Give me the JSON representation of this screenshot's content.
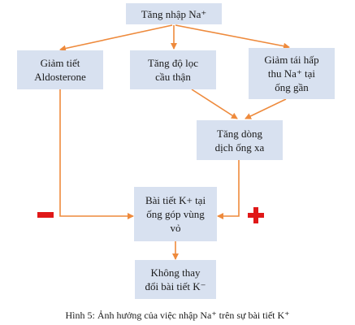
{
  "boxes": {
    "top": [
      "Tăng nhập Na⁺"
    ],
    "left": [
      "Giảm tiết",
      "Aldosterone"
    ],
    "middle": [
      "Tăng độ lọc",
      "cầu thận"
    ],
    "right": [
      "Giảm tái hấp",
      "thu Na⁺ tại",
      "ống gần"
    ],
    "distal": [
      "Tăng dòng",
      "dịch ống xa"
    ],
    "collect": [
      "Bài tiết K+ tại",
      "ống góp vùng",
      "vỏ"
    ],
    "result": [
      "Không thay",
      "đổi bài tiết K⁻"
    ]
  },
  "signs": {
    "left": "minus",
    "right": "plus"
  },
  "caption": "Hình 5: Ảnh hưởng của việc nhập Na⁺ trên sự bài tiết K⁺",
  "colors": {
    "box": "#d8e1f0",
    "arrow": "#ee8a3c",
    "sign": "#e01818"
  }
}
